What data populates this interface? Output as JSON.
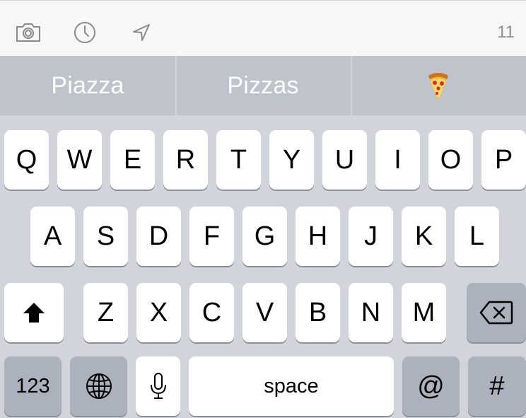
{
  "toolbar": {
    "icons": [
      "camera-icon",
      "clock-icon",
      "location-arrow-icon"
    ],
    "char_count": "11"
  },
  "suggestions": [
    "Piazza",
    "Pizzas",
    "🍕"
  ],
  "keyboard": {
    "row1": [
      "Q",
      "W",
      "E",
      "R",
      "T",
      "Y",
      "U",
      "I",
      "O",
      "P"
    ],
    "row2": [
      "A",
      "S",
      "D",
      "F",
      "G",
      "H",
      "J",
      "K",
      "L"
    ],
    "row3": [
      "Z",
      "X",
      "C",
      "V",
      "B",
      "N",
      "M"
    ],
    "numbers_label": "123",
    "space_label": "space",
    "at_label": "@",
    "hash_label": "#",
    "shift_icon": "shift-icon",
    "backspace_icon": "backspace-icon",
    "globe_icon": "globe-icon",
    "mic_icon": "microphone-icon"
  }
}
